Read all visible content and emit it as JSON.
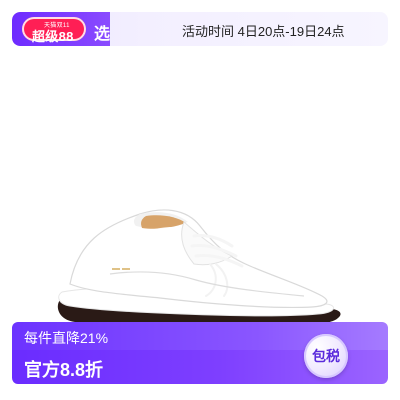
{
  "top_banner": {
    "badge_mini": "天猫双11",
    "badge_main": "超级88",
    "badge_select": "选",
    "activity_time": "活动时间  4日20点-19日24点"
  },
  "promo": {
    "line1": "每件直降21%",
    "line2": "官方8.8折",
    "tax_badge": "包税"
  },
  "colors": {
    "accent_purple": "#6c33ff",
    "badge_red": "#ff1f55",
    "shoe_sole": "#2a1a16"
  },
  "icons": {
    "badge": "promo-badge-icon",
    "product": "shoe-illustration"
  }
}
